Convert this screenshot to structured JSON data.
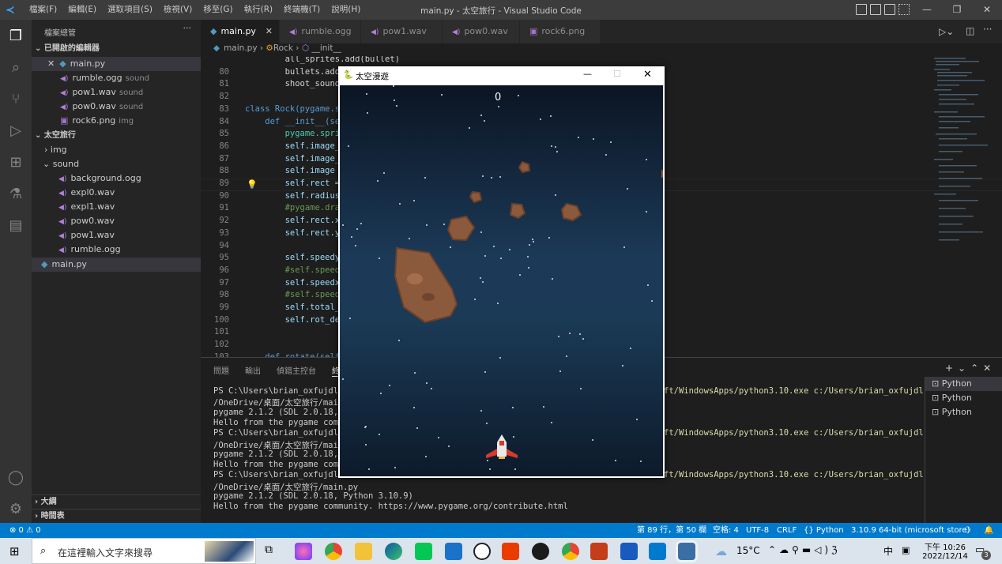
{
  "titlebar": {
    "menus": [
      "檔案(F)",
      "編輯(E)",
      "選取項目(S)",
      "檢視(V)",
      "移至(G)",
      "執行(R)",
      "終端機(T)",
      "說明(H)"
    ],
    "title": "main.py - 太空旅行 - Visual Studio Code"
  },
  "sidebar": {
    "header": "檔案總管",
    "open_editors": "已開啟的編輯器",
    "open_files": [
      {
        "name": "main.py",
        "sub": ""
      },
      {
        "name": "rumble.ogg",
        "sub": "sound"
      },
      {
        "name": "pow1.wav",
        "sub": "sound"
      },
      {
        "name": "pow0.wav",
        "sub": "sound"
      },
      {
        "name": "rock6.png",
        "sub": "img"
      }
    ],
    "project": "太空旅行",
    "folders": {
      "img": "img",
      "sound": "sound"
    },
    "sound_files": [
      "background.ogg",
      "expl0.wav",
      "expl1.wav",
      "pow0.wav",
      "pow1.wav",
      "rumble.ogg"
    ],
    "root_file": "main.py",
    "outline": "大綱",
    "timeline": "時間表"
  },
  "tabs": [
    "main.py",
    "rumble.ogg",
    "pow1.wav",
    "pow0.wav",
    "rock6.png"
  ],
  "breadcrumb": {
    "file": "main.py",
    "cls": "Rock",
    "method": "__init__"
  },
  "editor": {
    "lines": [
      {
        "n": "",
        "t": "        all_sprites.add(bullet)"
      },
      {
        "n": "80",
        "t": "        bullets.add(bullet)"
      },
      {
        "n": "81",
        "t": "        shoot_sound"
      },
      {
        "n": "82",
        "t": ""
      },
      {
        "n": "83",
        "t": "class Rock(pygame.s"
      },
      {
        "n": "84",
        "t": "    def __init__(se"
      },
      {
        "n": "85",
        "t": "        pygame.spri"
      },
      {
        "n": "86",
        "t": "        self.image_"
      },
      {
        "n": "87",
        "t": "        self.image_"
      },
      {
        "n": "88",
        "t": "        self.image "
      },
      {
        "n": "89",
        "t": "        self.rect ="
      },
      {
        "n": "90",
        "t": "        self.radius"
      },
      {
        "n": "91",
        "t": "        #pygame.dra"
      },
      {
        "n": "92",
        "t": "        self.rect.x"
      },
      {
        "n": "93",
        "t": "        self.rect.y"
      },
      {
        "n": "94",
        "t": ""
      },
      {
        "n": "95",
        "t": "        self.speedy"
      },
      {
        "n": "96",
        "t": "        #self.speed"
      },
      {
        "n": "97",
        "t": "        self.speedx"
      },
      {
        "n": "98",
        "t": "        #self.speed"
      },
      {
        "n": "99",
        "t": "        self.total_"
      },
      {
        "n": "100",
        "t": "        self.rot_de"
      },
      {
        "n": "101",
        "t": ""
      },
      {
        "n": "102",
        "t": ""
      },
      {
        "n": "103",
        "t": "    def rotate(self"
      }
    ]
  },
  "panel": {
    "tabs": [
      "問題",
      "輸出",
      "偵錯主控台",
      "終端"
    ],
    "terminals": [
      "Python",
      "Python",
      "Python"
    ],
    "lines": [
      "PS C:\\Users\\brian_oxfujdl\\O",
      "/OneDrive/桌面/太空旅行/mai",
      "pygame 2.1.2 (SDL 2.0.18, P",
      "Hello from the pygame commu",
      "PS C:\\Users\\brian_oxfujdl\\O",
      "/OneDrive/桌面/太空旅行/mai",
      "pygame 2.1.2 (SDL 2.0.18, P",
      "Hello from the pygame commu",
      "PS C:\\Users\\brian_oxfujdl\\O",
      "/OneDrive/桌面/太空旅行/main.py",
      "pygame 2.1.2 (SDL 2.0.18, Python 3.10.9)",
      "Hello from the pygame community. https://www.pygame.org/contribute.html"
    ],
    "right_part": "ft/WindowsApps/python3.10.exe c:/Users/brian_oxfujdl"
  },
  "statusbar": {
    "problems": "⊗ 0 ⚠ 0",
    "position": "第 89 行，第 50 欄",
    "spaces": "空格: 4",
    "encoding": "UTF-8",
    "eol": "CRLF",
    "language": "{} Python",
    "interpreter": "3.10.9 64-bit (microsoft store)"
  },
  "game": {
    "title": "太空漫遊",
    "score": "0"
  },
  "taskbar": {
    "search": "在這裡輸入文字來搜尋",
    "temp": "15°C",
    "lang": "中",
    "time": "下午 10:26",
    "date": "2022/12/14",
    "notif": "3"
  }
}
